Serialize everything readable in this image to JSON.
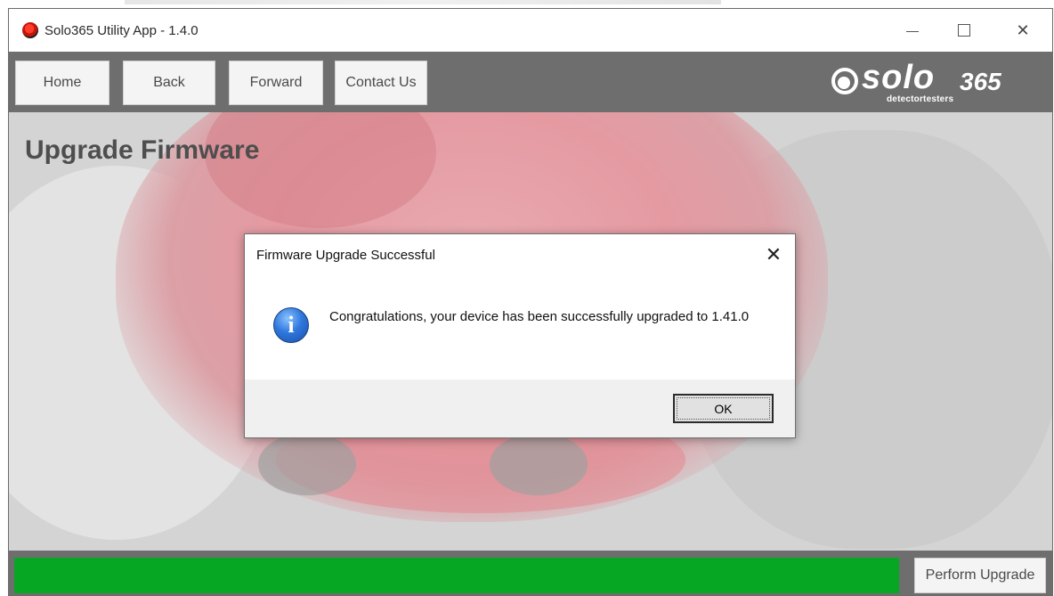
{
  "window": {
    "title": "Solo365 Utility App - 1.4.0",
    "controls": {
      "minimize_icon": "minimize-icon",
      "maximize_icon": "maximize-icon",
      "close_icon": "close-icon"
    }
  },
  "toolbar": {
    "home_label": "Home",
    "back_label": "Back",
    "forward_label": "Forward",
    "contact_label": "Contact Us",
    "logo": {
      "word": "solo",
      "number": "365",
      "tagline": "detectortesters"
    }
  },
  "main": {
    "page_title": "Upgrade Firmware"
  },
  "footer": {
    "progress_percent": 100,
    "progress_color": "#06a823",
    "perform_label": "Perform Upgrade"
  },
  "dialog": {
    "title": "Firmware Upgrade Successful",
    "close_glyph": "✕",
    "icon": "info-icon",
    "icon_glyph": "i",
    "message": "Congratulations, your device has been successfully upgraded to 1.41.0",
    "ok_label": "OK"
  }
}
